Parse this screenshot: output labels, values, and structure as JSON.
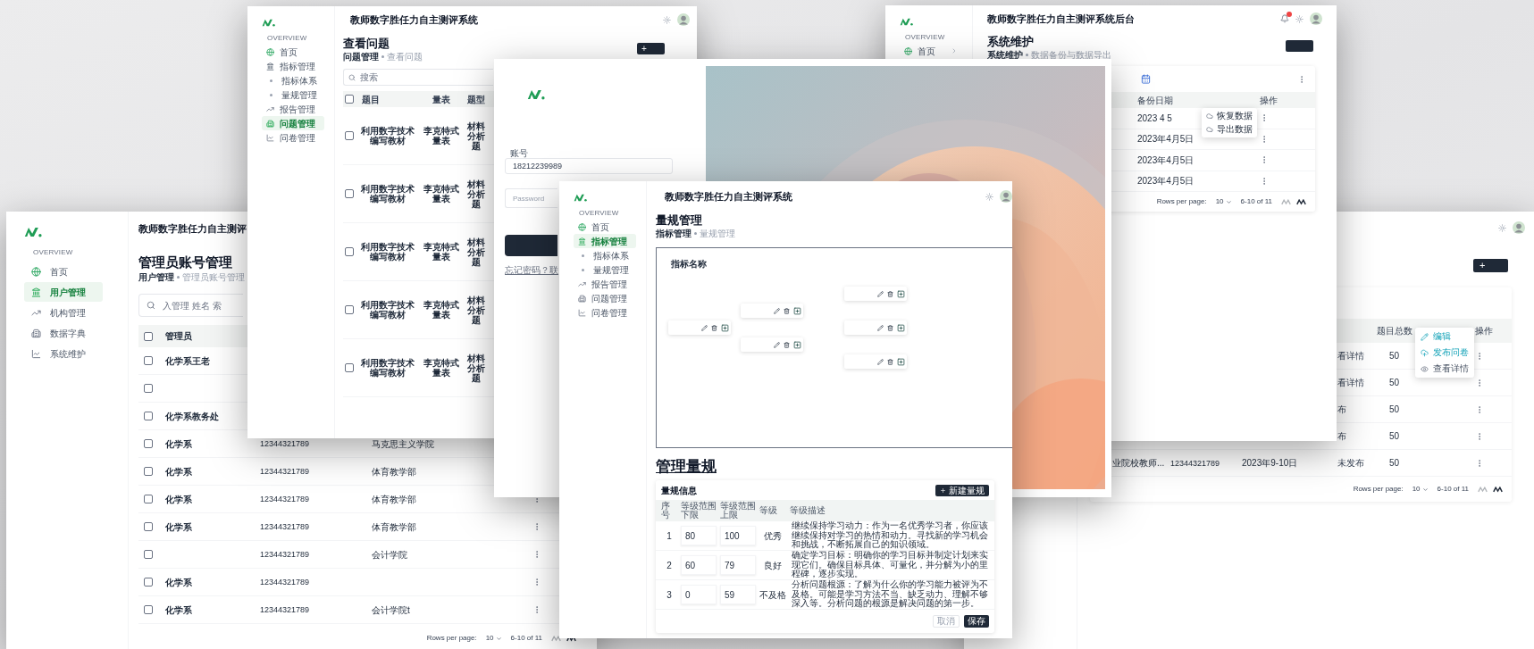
{
  "windows": [
    {
      "kind": "accounts",
      "sidebar": {
        "section": "OVERVIEW",
        "items": [
          {
            "label": "首页",
            "kind": "item",
            "selected": false
          },
          {
            "label": "用户管理",
            "kind": "item",
            "selected": true
          },
          {
            "label": "机构管理",
            "kind": "item",
            "selected": false
          },
          {
            "label": "数据字典",
            "kind": "item",
            "selected": false
          },
          {
            "label": "系统维护",
            "kind": "item",
            "selected": false
          }
        ]
      },
      "header_title": "教师数字胜任力自主测评",
      "page_title": "管理员账号管理",
      "breadcrumb": [
        "用户管理",
        "管理员账号管理"
      ],
      "search": {
        "placeholder": "入管理 姓名 索"
      },
      "table": {
        "columns": [
          "管理员"
        ],
        "header_checked": false,
        "rows": [
          {
            "checked": false,
            "name": "化学系王老"
          },
          {
            "checked": false
          },
          {
            "checked": false,
            "name": "化学系教务处"
          },
          {
            "checked": false,
            "name": "化学系",
            "phone": "12344321789",
            "department": "马克思主义学院"
          },
          {
            "checked": false,
            "name": "化学系",
            "phone": "12344321789",
            "department": "体育教学部"
          },
          {
            "checked": false,
            "name": "化学系",
            "phone": "12344321789",
            "department": "体育教学部",
            "menu": true
          },
          {
            "checked": false,
            "name": "化学系",
            "phone": "12344321789",
            "department": "体育教学部",
            "menu": true
          },
          {
            "checked": false,
            "phone": "12344321789",
            "department": "会计学院",
            "menu": true
          },
          {
            "checked": false,
            "name": "化学系",
            "phone": "12344321789",
            "menu": true
          },
          {
            "checked": false,
            "name": "化学系",
            "phone": "12344321789",
            "department": "会计学院t",
            "menu": true
          }
        ]
      },
      "pagination": {
        "label": "Rows per page:",
        "page_size": "10",
        "range": "6-10 of 11"
      }
    },
    {
      "kind": "questions",
      "sidebar": {
        "section": "OVERVIEW",
        "items": [
          {
            "label": "首页",
            "kind": "item",
            "selected": false
          },
          {
            "label": "指标管理",
            "kind": "item",
            "selected": false
          },
          {
            "label": "指标体系",
            "kind": "sub",
            "selected": false
          },
          {
            "label": "量规管理",
            "kind": "sub",
            "selected": false
          },
          {
            "label": "报告管理",
            "kind": "item",
            "selected": false
          },
          {
            "label": "问题管理",
            "kind": "item",
            "selected": true
          },
          {
            "label": "问卷管理",
            "kind": "item",
            "selected": false
          }
        ]
      },
      "header_title": "教师数字胜任力自主测评系统",
      "page_title": "查看问题",
      "breadcrumb": [
        "问题管理",
        "查看问题"
      ],
      "add_button": "+",
      "search": {
        "placeholder": "搜索"
      },
      "table": {
        "columns": [
          "题目",
          "量表",
          "题型"
        ],
        "header_checked": false,
        "rows": [
          {
            "checked": false,
            "title": "利用数字技术编写教材",
            "scale": "李克特式量表",
            "type": "材料分析题"
          },
          {
            "checked": false,
            "title": "利用数字技术编写教材",
            "scale": "李克特式量表",
            "type": "材料分析题"
          },
          {
            "checked": false,
            "title": "利用数字技术编写教材",
            "scale": "李克特式量表",
            "type": "材料分析题"
          },
          {
            "checked": false,
            "title": "利用数字技术编写教材",
            "scale": "李克特式量表",
            "type": "材料分析题"
          },
          {
            "checked": false,
            "title": "利用数字技术编写教材",
            "scale": "李克特式量表",
            "type": "材料分析题"
          }
        ]
      }
    },
    {
      "kind": "login",
      "account": {
        "label": "账号",
        "value": "18212239989"
      },
      "password": {
        "placeholder": "Password"
      },
      "forgot_link": "忘记密码？联"
    },
    {
      "kind": "rubric",
      "sidebar": {
        "section": "OVERVIEW",
        "items": [
          {
            "label": "首页",
            "kind": "item",
            "selected": false
          },
          {
            "label": "指标管理",
            "kind": "item",
            "selected": true
          },
          {
            "label": "指标体系",
            "kind": "sub",
            "selected": false
          },
          {
            "label": "量规管理",
            "kind": "sub",
            "selected": false
          },
          {
            "label": "报告管理",
            "kind": "item",
            "selected": false
          },
          {
            "label": "问题管理",
            "kind": "item",
            "selected": false
          },
          {
            "label": "问卷管理",
            "kind": "item",
            "selected": false
          }
        ]
      },
      "header_title": "教师数字胜任力自主测评系统",
      "page_title": "量规管理",
      "breadcrumb": [
        "指标管理",
        "量规管理"
      ],
      "tree": {
        "label": "指标名称",
        "nodes": [
          {
            "kind": "node",
            "children": [
              {
                "kind": "node",
                "children": [
                  {
                    "kind": "node"
                  }
                ]
              },
              {
                "kind": "node",
                "children": [
                  {
                    "kind": "node"
                  },
                  {
                    "kind": "node"
                  }
                ]
              }
            ]
          }
        ]
      },
      "section_title": "管理量规",
      "card_title": "量规信息",
      "new_button": "新建量规",
      "columns": [
        "序号",
        "等级范围下限",
        "等级范围上限",
        "等级",
        "等级描述"
      ],
      "rows": [
        {
          "index": "1",
          "lower": "80",
          "upper": "100",
          "grade": "优秀",
          "description": "继续保持学习动力：作为一名优秀学习者，你应该继续保持对学习的热情和动力。寻找新的学习机会和挑战，不断拓展自己的知识领域。"
        },
        {
          "index": "2",
          "lower": "60",
          "upper": "79",
          "grade": "良好",
          "description": "确定学习目标：明确你的学习目标并制定计划来实现它们。确保目标具体、可量化，并分解为小的里程碑，逐步实现。"
        },
        {
          "index": "3",
          "lower": "0",
          "upper": "59",
          "grade": "不及格",
          "description": "分析问题根源：了解为什么你的学习能力被评为不及格。可能是学习方法不当、缺乏动力、理解不够深入等。分析问题的根源是解决问题的第一步。"
        }
      ],
      "buttons": [
        "取消",
        "保存"
      ]
    },
    {
      "kind": "maintenance",
      "sidebar": {
        "section": "OVERVIEW",
        "items": [
          {
            "label": "首页",
            "kind": "expandable",
            "selected": false
          }
        ]
      },
      "header_title": "教师数字胜任力自主测评系统后台",
      "page_title": "系统维护",
      "breadcrumb": [
        "系统维护",
        "数据备份与数据导出"
      ],
      "table": {
        "columns": [
          "备份日期",
          "操作"
        ],
        "rows": [
          {
            "date": "2023 4 5"
          },
          {
            "date": "2023年4月5日"
          },
          {
            "date": "2023年4月5日"
          },
          {
            "date": "2023年4月5日"
          }
        ]
      },
      "menu": [
        {
          "label": "恢复数据"
        },
        {
          "label": "导出数据"
        }
      ],
      "pagination": {
        "label": "Rows per page:",
        "page_size": "10",
        "range": "6-10 of 11"
      }
    },
    {
      "kind": "questionnaires",
      "add_button": "+",
      "table": {
        "columns": [
          "题目总数",
          "操作"
        ],
        "rows": [
          {
            "status": "看详情",
            "count": "50"
          },
          {
            "status": "看详情",
            "count": "50"
          },
          {
            "status": "布",
            "count": "50"
          },
          {
            "status": "布",
            "count": "50"
          },
          {
            "name": "业院校教师...",
            "phone": "12344321789",
            "date": "2023年9-10日",
            "status": "未发布",
            "count": "50"
          }
        ]
      },
      "menu": [
        {
          "label": "编辑",
          "highlighted": true
        },
        {
          "label": "发布问卷",
          "highlighted": true
        },
        {
          "label": "查看详情",
          "highlighted": false
        }
      ],
      "pagination": {
        "label": "Rows per page:",
        "page_size": "10",
        "range": "6-10 of 11"
      }
    }
  ]
}
